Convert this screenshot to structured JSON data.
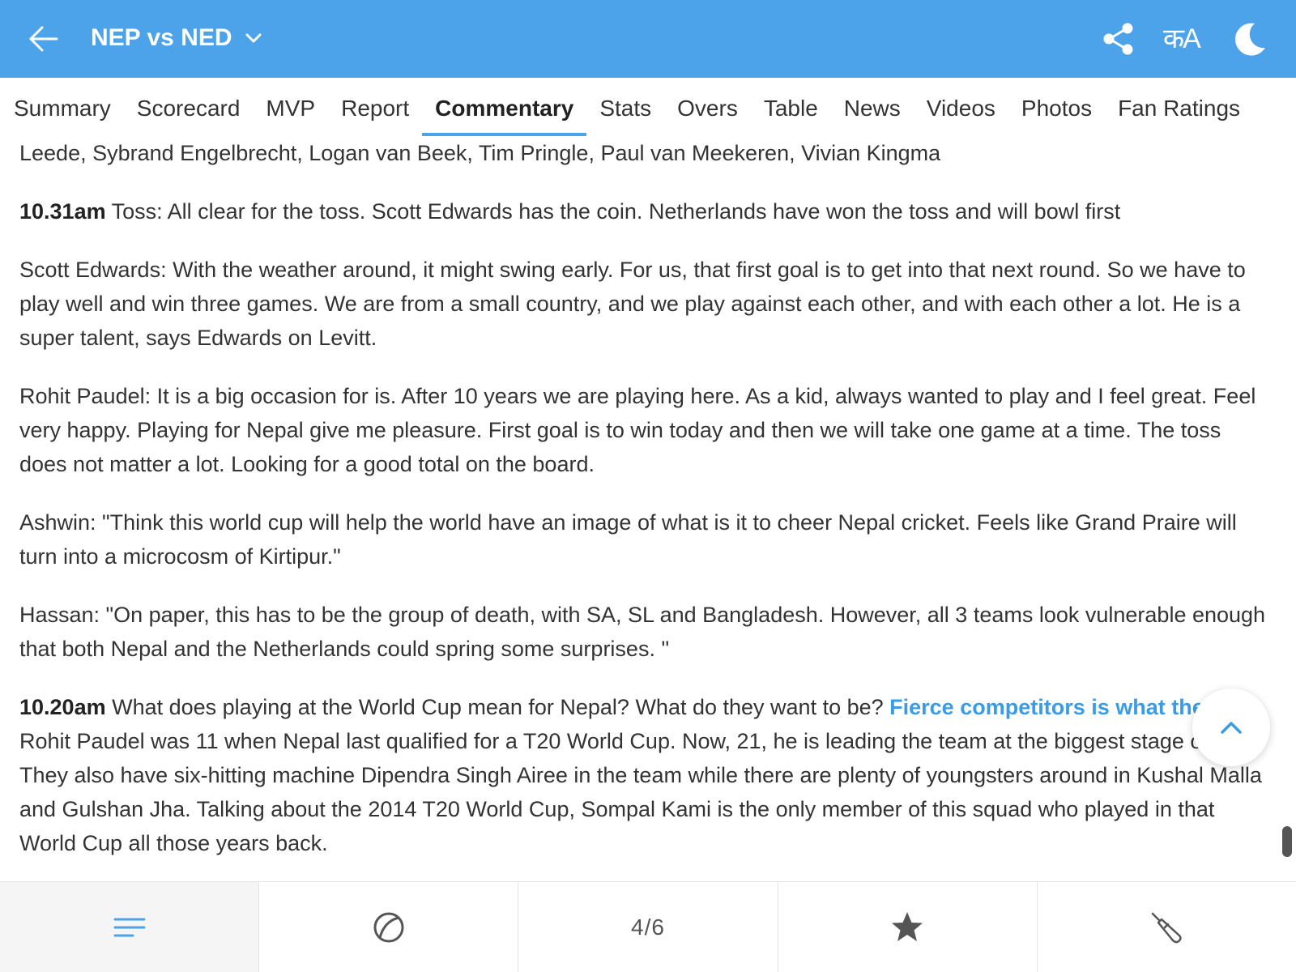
{
  "header": {
    "match_title": "NEP vs NED",
    "lang_label": "कA",
    "accent_color": "#4ca3e9",
    "icons": [
      "back-arrow-icon",
      "chevron-down-icon",
      "share-icon",
      "moon-icon"
    ]
  },
  "tabs": [
    {
      "label": "Summary"
    },
    {
      "label": "Scorecard"
    },
    {
      "label": "MVP"
    },
    {
      "label": "Report"
    },
    {
      "label": "Commentary",
      "active": true
    },
    {
      "label": "Stats"
    },
    {
      "label": "Overs"
    },
    {
      "label": "Table"
    },
    {
      "label": "News"
    },
    {
      "label": "Videos"
    },
    {
      "label": "Photos"
    },
    {
      "label": "Fan Ratings"
    }
  ],
  "commentary": {
    "entry_0": {
      "text": "Leede, Sybrand Engelbrecht, Logan van Beek, Tim Pringle, Paul van Meekeren, Vivian Kingma"
    },
    "entry_1": {
      "time": "10.31am",
      "text": " Toss: All clear for the toss. Scott Edwards has the coin. Netherlands have won the toss and will bowl first"
    },
    "entry_2": {
      "text": "Scott Edwards: With the weather around, it might swing early. For us, that first goal is to get into that next round. So we have to play well and win three games. We are from a small country, and we play against each other, and with each other a lot. He is a super talent, says Edwards on Levitt."
    },
    "entry_3": {
      "text": "Rohit Paudel: It is a big occasion for is. After 10 years we are playing here. As a kid, always wanted to play and I feel great. Feel very happy. Playing for Nepal give me pleasure. First goal is to win today and then we will take one game at a time. The toss does not matter a lot. Looking for a good total on the board."
    },
    "entry_4": {
      "text": "Ashwin: \"Think this world cup will help the world have an image of what is it to cheer Nepal cricket. Feels like Grand Praire will turn into a microcosm of Kirtipur.\""
    },
    "entry_5": {
      "text": "Hassan: \"On paper, this has to be the group of death, with SA, SL and Bangladesh. However, all 3 teams look vulnerable enough that both Nepal and the Netherlands could spring some surprises. \""
    },
    "entry_6": {
      "time": "10.20am",
      "text_before": " What does playing at the World Cup mean for Nepal? What do they want to be? ",
      "link": "Fierce competitors is what they say",
      "text_after": ". Rohit Paudel was 11 when Nepal last qualified for a T20 World Cup. Now, 21, he is leading the team at the biggest stage of it all. They also have six-hitting machine Dipendra Singh Airee in the team while there are plenty of youngsters around in Kushal Malla and Gulshan Jha. Talking about the 2014 T20 World Cup, Sompal Kami is the only member of this squad who played in that World Cup all those years back."
    },
    "link_color": "#3a9ce6"
  },
  "bottom_bar": {
    "counter": "4/6",
    "icons": [
      "menu-lines-icon",
      "ball-icon",
      "star-icon",
      "bat-icon"
    ]
  }
}
